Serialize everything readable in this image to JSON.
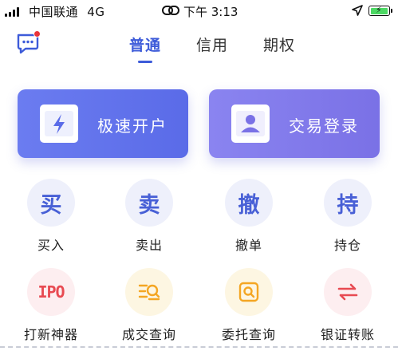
{
  "status_bar": {
    "carrier": "中国联通",
    "network": "4G",
    "time": "下午 3:13"
  },
  "header": {
    "tabs": [
      {
        "label": "普通",
        "active": true
      },
      {
        "label": "信用",
        "active": false
      },
      {
        "label": "期权",
        "active": false
      }
    ]
  },
  "main": {
    "primary_actions": [
      {
        "label": "极速开户",
        "icon": "lightning-icon"
      },
      {
        "label": "交易登录",
        "icon": "user-icon"
      }
    ],
    "row1": [
      {
        "glyph": "买",
        "label": "买入"
      },
      {
        "glyph": "卖",
        "label": "卖出"
      },
      {
        "glyph": "撤",
        "label": "撤单"
      },
      {
        "glyph": "持",
        "label": "持仓"
      }
    ],
    "row2": [
      {
        "glyph": "IPO",
        "label": "打新神器",
        "icon": "ipo-icon"
      },
      {
        "label": "成交查询",
        "icon": "list-search-icon"
      },
      {
        "label": "委托查询",
        "icon": "order-search-icon"
      },
      {
        "label": "银证转账",
        "icon": "transfer-arrows-icon"
      }
    ]
  },
  "colors": {
    "accent": "#3d5bd9",
    "badge": "#e8333a",
    "button_left": "#6b7cf0",
    "button_right": "#8a84f0",
    "ipo_red": "#e84a52",
    "search_orange": "#f4a623"
  }
}
